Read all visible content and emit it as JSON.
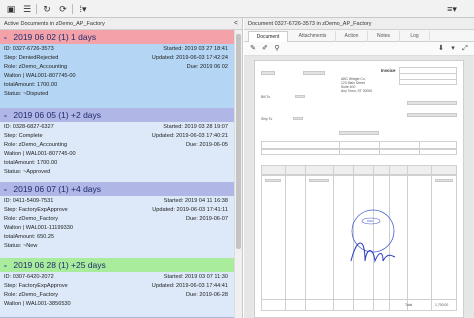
{
  "toolbar": {
    "buttons": [
      "window-icon",
      "list-icon",
      "refresh-icon",
      "sync-icon",
      "pipe-icon",
      "dropdown-icon"
    ],
    "right_menu": "menu-icon"
  },
  "list_panel": {
    "title": "Active Documents in zDemo_AP_Factory",
    "collapse": "<"
  },
  "groups": [
    {
      "header": "2019 06 02 (1)  1 days",
      "sign": "-",
      "color": "#f4a2aa",
      "item": {
        "id": "ID: 0327-6726-3573",
        "started": "Started: 2019 03 27 18:41",
        "step": "Step: DeniedRejected",
        "updated": "Updated: 2019-06-03 17:42:24",
        "role": "Role: zDemo_Accounting",
        "due": "Due: 2019 06 02",
        "walton": "Walton | WAL001-807745-00",
        "total": "totalAmount: 1700.00",
        "status": "Status: ~Disputed"
      }
    },
    {
      "header": "2019 06 05 (1)  +2 days",
      "sign": "-",
      "color": "#b0b6e6",
      "item": {
        "id": "ID: 0328-6827-6327",
        "started": "Started: 2019 03 28 19:07",
        "step": "Step: Complete",
        "updated": "Updated: 2019-06-03 17:40:21",
        "role": "Role: zDemo_Accounting",
        "due": "Due: 2019-06-05",
        "walton": "Walton | WAL001-807745-00",
        "total": "totalAmount: 1700.00",
        "status": "Status: ~Approved"
      }
    },
    {
      "header": "2019 06 07 (1)  +4 days",
      "sign": "-",
      "color": "#b0b6e6",
      "item": {
        "id": "ID: 0411-5409-7531",
        "started": "Started: 2019 04 11 16:38",
        "step": "Step: FactoryExpApprove",
        "updated": "Updated: 2019-06-03 17:41:11",
        "role": "Role: zDemo_Factory",
        "due": "Due: 2019-06-07",
        "walton": "Walton | WAL001-11199330",
        "total": "totalAmount: 650.25",
        "status": "Status: ~New"
      }
    },
    {
      "header": "2019 06 28 (1)  +25 days",
      "sign": "-",
      "color": "#a8ec9c",
      "item": {
        "id": "ID: 0307-6420-2072",
        "started": "Started: 2019 03 07 11:30",
        "step": "Step: FactoryExpApprove",
        "updated": "Updated: 2019-06-03 17:44:41",
        "role": "Role: zDemo_Factory",
        "due": "Due: 2019-06-28",
        "walton": "Walton | WAL001-3856530"
      }
    }
  ],
  "doc_panel": {
    "title": "Document 0327-6726-3573 in zDemo_AP_Factory",
    "tabs": [
      "Document",
      "Attachments",
      "Action",
      "Notes",
      "Log"
    ],
    "active_tab": "Document"
  },
  "invoice": {
    "heading": "Invoice",
    "vendor_name": "ABC Widget Co.",
    "vendor_lines": [
      "123 Main Street",
      "Suite 400",
      "Any Town, ST 00000"
    ],
    "bill_to": "Bill To",
    "ship_to": "Ship To",
    "total_label": "Total",
    "total_value": "1,700.00",
    "stamp": "PAID"
  },
  "colors": {
    "overdue": "#f4a2aa",
    "soon": "#b0b6e6",
    "later": "#a8ec9c",
    "selected": "#b4d6f4"
  }
}
